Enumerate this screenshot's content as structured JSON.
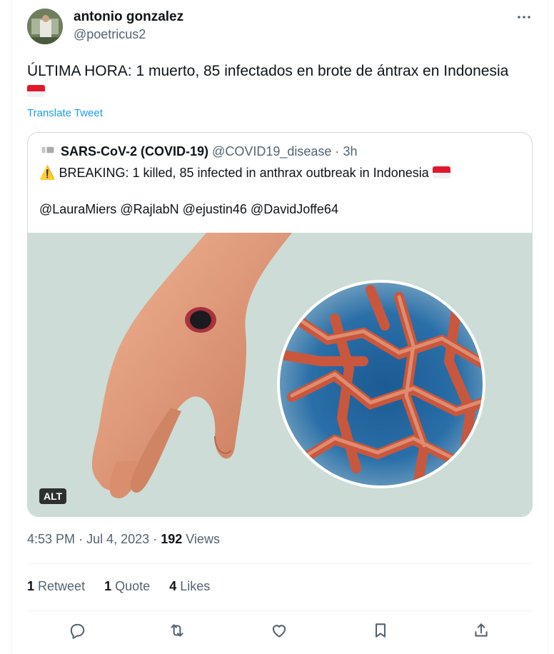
{
  "tweet": {
    "author_name": "antonio gonzalez",
    "author_handle": "@poetricus2",
    "text": "ÚLTIMA HORA: 1 muerto, 85 infectados en brote de ántrax en Indonesia",
    "translate_label": "Translate Tweet",
    "more_icon": "more-icon"
  },
  "quoted": {
    "name": "SARS-CoV-2 (COVID-19)",
    "handle": "@COVID19_disease",
    "dot": "·",
    "time": "3h",
    "warning_icon": "⚠️",
    "text": "BREAKING: 1 killed, 85 infected in anthrax outbreak in Indonesia",
    "mentions": "@LauraMiers @RajlabN @ejustin46 @DavidJoffe64",
    "alt_label": "ALT"
  },
  "meta": {
    "time": "4:53 PM",
    "sep1": "·",
    "date": "Jul 4, 2023",
    "sep2": "·",
    "views_count": "192",
    "views_label": "Views"
  },
  "stats": {
    "retweets_count": "1",
    "retweets_label": "Retweet",
    "quotes_count": "1",
    "quotes_label": "Quote",
    "likes_count": "4",
    "likes_label": "Likes"
  },
  "colors": {
    "link": "#1d9bf0",
    "secondary_text": "#536471",
    "primary_text": "#0f1419"
  }
}
